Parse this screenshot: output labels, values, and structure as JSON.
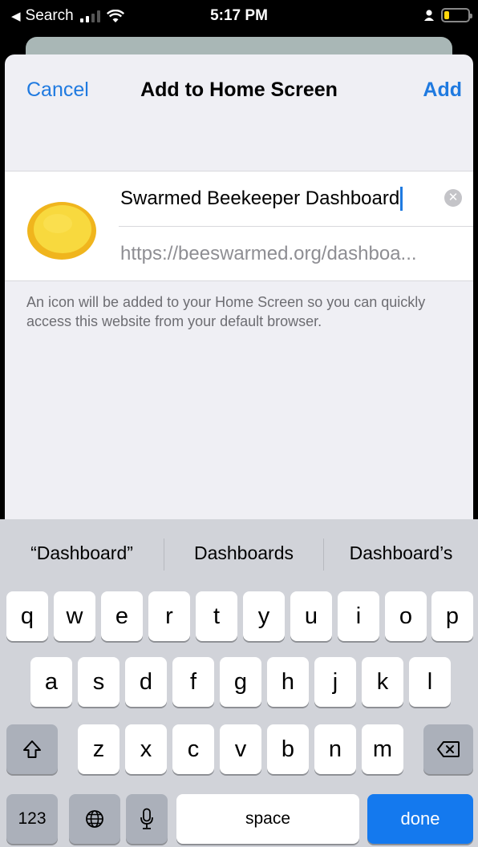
{
  "status_bar": {
    "back_label": "Search",
    "time": "5:17 PM"
  },
  "nav": {
    "cancel": "Cancel",
    "title": "Add to Home Screen",
    "add": "Add"
  },
  "form": {
    "name_value": "Swarmed Beekeeper Dashboard",
    "url": "https://beeswarmed.org/dashboa...",
    "description": "An icon will be added to your Home Screen so you can quickly access this website from your default browser."
  },
  "keyboard": {
    "suggestions": [
      "“Dashboard”",
      "Dashboards",
      "Dashboard’s"
    ],
    "row1": [
      "q",
      "w",
      "e",
      "r",
      "t",
      "y",
      "u",
      "i",
      "o",
      "p"
    ],
    "row2": [
      "a",
      "s",
      "d",
      "f",
      "g",
      "h",
      "j",
      "k",
      "l"
    ],
    "row3": [
      "z",
      "x",
      "c",
      "v",
      "b",
      "n",
      "m"
    ],
    "numbers_key": "123",
    "space_key": "space",
    "done_key": "done"
  },
  "colors": {
    "accent": "#1f7ae0",
    "done_key": "#1479ee",
    "icon_yellow": "#f4c52a"
  }
}
